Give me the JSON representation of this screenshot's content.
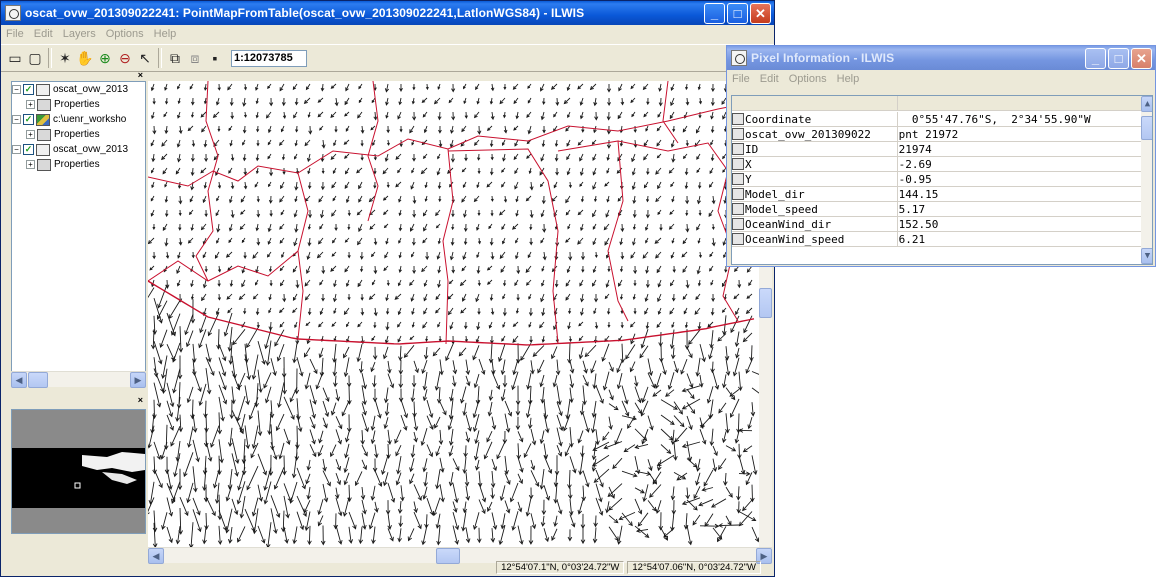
{
  "main_window": {
    "title": "oscat_ovw_201309022241: PointMapFromTable(oscat_ovw_201309022241,LatlonWGS84) - ILWIS",
    "menu": [
      "File",
      "Edit",
      "Layers",
      "Options",
      "Help"
    ],
    "scale": "1:12073785",
    "layers": [
      {
        "type": "point",
        "name": "oscat_ovw_2013"
      },
      {
        "type": "props",
        "name": "Properties"
      },
      {
        "type": "raster",
        "name": "c:\\uenr_worksho"
      },
      {
        "type": "props",
        "name": "Properties"
      },
      {
        "type": "point",
        "name": "oscat_ovw_2013"
      },
      {
        "type": "props",
        "name": "Properties"
      }
    ],
    "status": [
      "12°54'07.1\"N, 0°03'24.72\"W",
      "12°54'07.06\"N, 0°03'24.72\"W"
    ]
  },
  "pixel_window": {
    "title": "Pixel Information - ILWIS",
    "menu": [
      "File",
      "Edit",
      "Options",
      "Help"
    ],
    "rows": [
      {
        "field": "Coordinate",
        "value": "  0°55'47.76\"S,  2°34'55.90\"W",
        "icon": "coordinate-icon"
      },
      {
        "field": "oscat_ovw_201309022",
        "value": "pnt 21972",
        "icon": "pointmap-icon"
      },
      {
        "field": "ID",
        "value": "21974",
        "icon": "column-icon"
      },
      {
        "field": "X",
        "value": "-2.69",
        "icon": "column-icon"
      },
      {
        "field": "Y",
        "value": "-0.95",
        "icon": "column-icon"
      },
      {
        "field": "Model_dir",
        "value": "144.15",
        "icon": "column-icon"
      },
      {
        "field": "Model_speed",
        "value": "5.17",
        "icon": "column-icon"
      },
      {
        "field": "OceanWind_dir",
        "value": "152.50",
        "icon": "column-icon"
      },
      {
        "field": "OceanWind_speed",
        "value": "6.21",
        "icon": "column-icon"
      }
    ]
  },
  "colors": {
    "border_lines": "#c8102e",
    "arrows": "#1a1a1a",
    "title_active": "#0a58d8",
    "title_inactive": "#7495e0"
  }
}
